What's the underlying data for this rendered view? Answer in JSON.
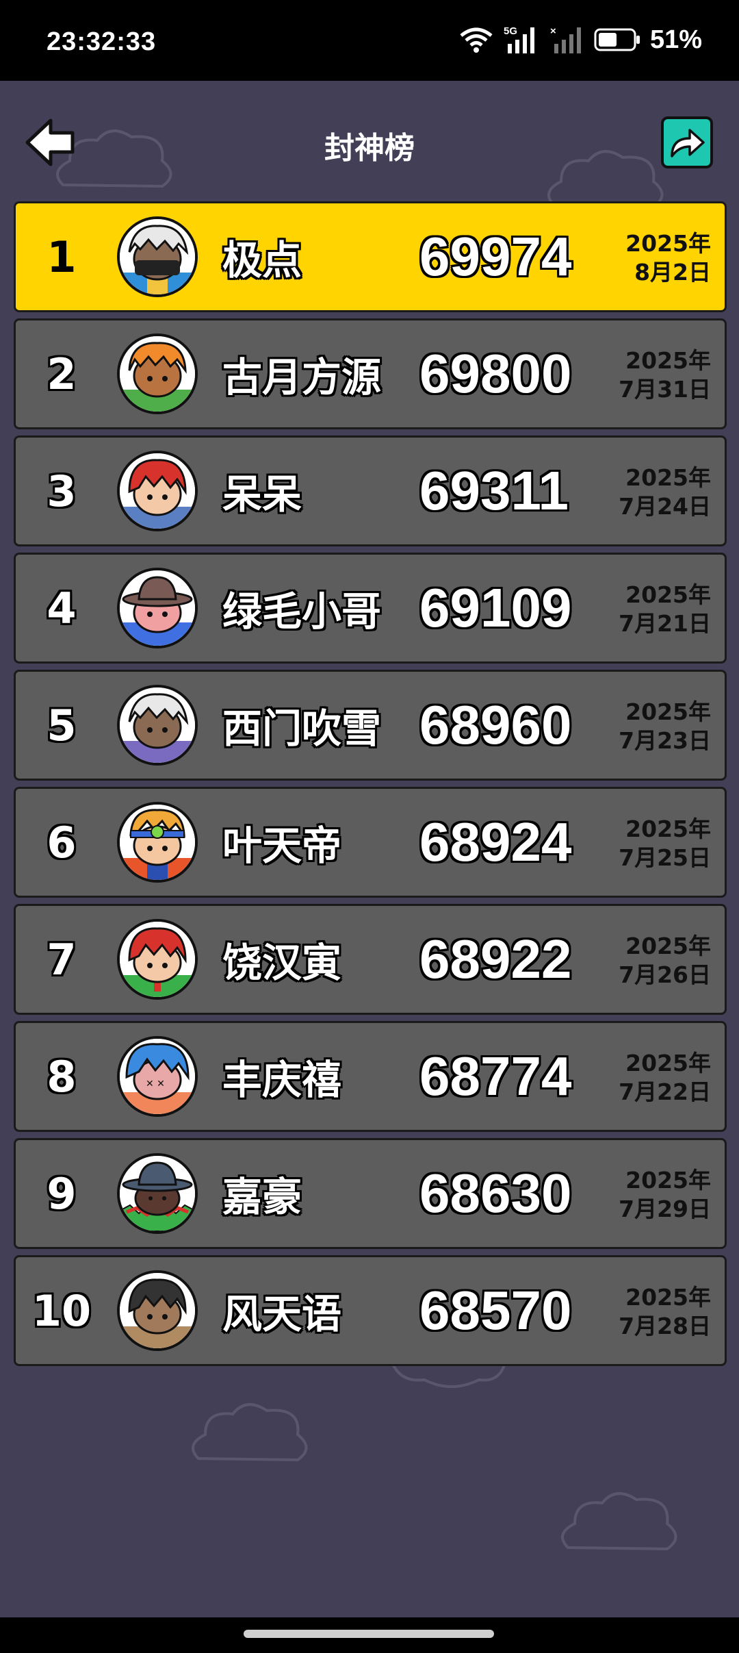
{
  "status_bar": {
    "time": "23:32:33",
    "battery": "51%",
    "network": "5G"
  },
  "header": {
    "title": "封神榜",
    "back_icon": "arrow-left-icon",
    "share_icon": "share-arrow-icon"
  },
  "colors": {
    "background": "#433f57",
    "row": "#5d5d5d",
    "first_row": "#ffd400",
    "share_button": "#1ec7b0"
  },
  "leaderboard": [
    {
      "rank": "1",
      "name": "极点",
      "score": "69974",
      "date_year": "2025年",
      "date_day": "8月2日"
    },
    {
      "rank": "2",
      "name": "古月方源",
      "score": "69800",
      "date_year": "2025年",
      "date_day": "7月31日"
    },
    {
      "rank": "3",
      "name": "呆呆",
      "score": "69311",
      "date_year": "2025年",
      "date_day": "7月24日"
    },
    {
      "rank": "4",
      "name": "绿毛小哥",
      "score": "69109",
      "date_year": "2025年",
      "date_day": "7月21日"
    },
    {
      "rank": "5",
      "name": "西门吹雪",
      "score": "68960",
      "date_year": "2025年",
      "date_day": "7月23日"
    },
    {
      "rank": "6",
      "name": "叶天帝",
      "score": "68924",
      "date_year": "2025年",
      "date_day": "7月25日"
    },
    {
      "rank": "7",
      "name": "饶汉寅",
      "score": "68922",
      "date_year": "2025年",
      "date_day": "7月26日"
    },
    {
      "rank": "8",
      "name": "丰庆禧",
      "score": "68774",
      "date_year": "2025年",
      "date_day": "7月22日"
    },
    {
      "rank": "9",
      "name": "嘉豪",
      "score": "68630",
      "date_year": "2025年",
      "date_day": "7月29日"
    },
    {
      "rank": "10",
      "name": "风天语",
      "score": "68570",
      "date_year": "2025年",
      "date_day": "7月28日"
    }
  ]
}
